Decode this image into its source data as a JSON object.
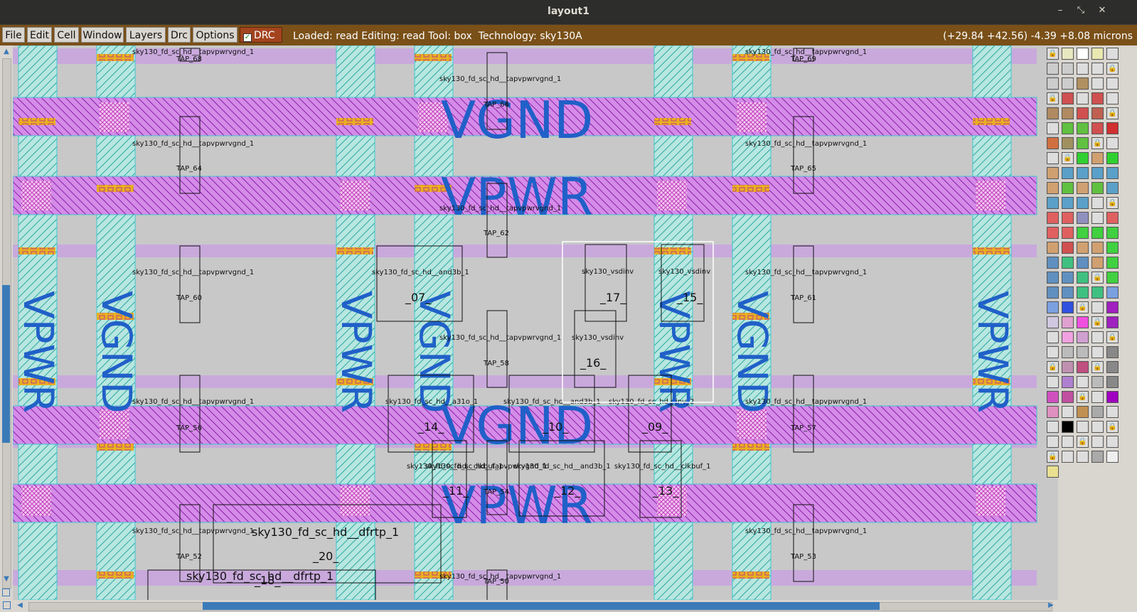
{
  "window": {
    "title": "layout1",
    "controls": [
      "–",
      "⤡",
      "✕"
    ]
  },
  "menu": {
    "items": [
      "File",
      "Edit",
      "Cell",
      "Window",
      "Layers",
      "Drc",
      "Options"
    ],
    "drc_toggle": "DRC",
    "status": "Loaded: read Editing: read Tool: box  Technology: sky130A",
    "coords": "(+29.84 +42.56) -4.39 +8.08 microns"
  },
  "colors": {
    "menubar": "#7a5018",
    "canvas": "#c8c8c8",
    "metal_rail": "#c070e0",
    "nwell": "#a8e0d8",
    "label_blue": "#2060c8",
    "scroll_thumb": "#3b7ab8"
  },
  "layout": {
    "big_labels": [
      "VGND",
      "VPWR",
      "VGND",
      "VPWR"
    ],
    "vertical_labels": [
      "VPWR",
      "VGND",
      "VPWR",
      "VGND",
      "VPWR",
      "VGND",
      "VPWR"
    ],
    "cells": [
      {
        "name": "sky130_fd_sc_hd__tapvpwrvgnd_1",
        "inst": "TAP_68"
      },
      {
        "name": "sky130_fd_sc_hd__tapvpwrvgnd_1",
        "inst": "TAP_69"
      },
      {
        "name": "sky130_fd_sc_hd__tapvpwrvgnd_1",
        "inst": "TAP_66"
      },
      {
        "name": "sky130_fd_sc_hd__tapvpwrvgnd_1",
        "inst": "TAP_64"
      },
      {
        "name": "sky130_fd_sc_hd__tapvpwrvgnd_1",
        "inst": "TAP_65"
      },
      {
        "name": "sky130_fd_sc_hd__tapvpwrvgnd_1",
        "inst": "TAP_62"
      },
      {
        "name": "sky130_fd_sc_hd__tapvpwrvgnd_1",
        "inst": "TAP_60"
      },
      {
        "name": "sky130_fd_sc_hd__and3b_1",
        "inst": "_07_"
      },
      {
        "name": "sky130_vsdinv",
        "inst": "_17_"
      },
      {
        "name": "sky130_vsdinv",
        "inst": "_15_"
      },
      {
        "name": "sky130_fd_sc_hd__tapvpwrvgnd_1",
        "inst": "TAP_61"
      },
      {
        "name": "sky130_fd_sc_hd__tapvpwrvgnd_1",
        "inst": "TAP_58"
      },
      {
        "name": "sky130_vsdinv",
        "inst": "_16_"
      },
      {
        "name": "sky130_fd_sc_hd__tapvpwrvgnd_1",
        "inst": "TAP_56"
      },
      {
        "name": "sky130_fd_sc_hd__a31o_1",
        "inst": "_14_"
      },
      {
        "name": "sky130_fd_sc_hd__and3b_1",
        "inst": "_10_"
      },
      {
        "name": "sky130_fd_sc_hd__inv_2",
        "inst": "_09_"
      },
      {
        "name": "sky130_fd_sc_hd__tapvpwrvgnd_1",
        "inst": "TAP_57"
      },
      {
        "name": "sky130_fd_sc_hd__clkbuf_1",
        "inst": "_11_"
      },
      {
        "name": "sky130_fd_sc_hd__tapvpwrvgnd_1",
        "inst": "TAP_54"
      },
      {
        "name": "sky130_fd_sc_hd__and3b_1",
        "inst": "_12_"
      },
      {
        "name": "sky130_fd_sc_hd__clkbuf_1",
        "inst": "_13_"
      },
      {
        "name": "sky130_fd_sc_hd__tapvpwrvgnd_1",
        "inst": "TAP_52"
      },
      {
        "name": "sky130_fd_sc_hd__dfrtp_1",
        "inst": "_20_"
      },
      {
        "name": "sky130_fd_sc_hd__tapvpwrvgnd_1",
        "inst": "TAP_53"
      },
      {
        "name": "sky130_fd_sc_hd__dfrtp_1",
        "inst": "_18_"
      },
      {
        "name": "sky130_fd_sc_hd__tapvpwrvgnd_1",
        "inst": "TAP_50"
      }
    ]
  },
  "palette": {
    "note_layers_visible": true
  }
}
